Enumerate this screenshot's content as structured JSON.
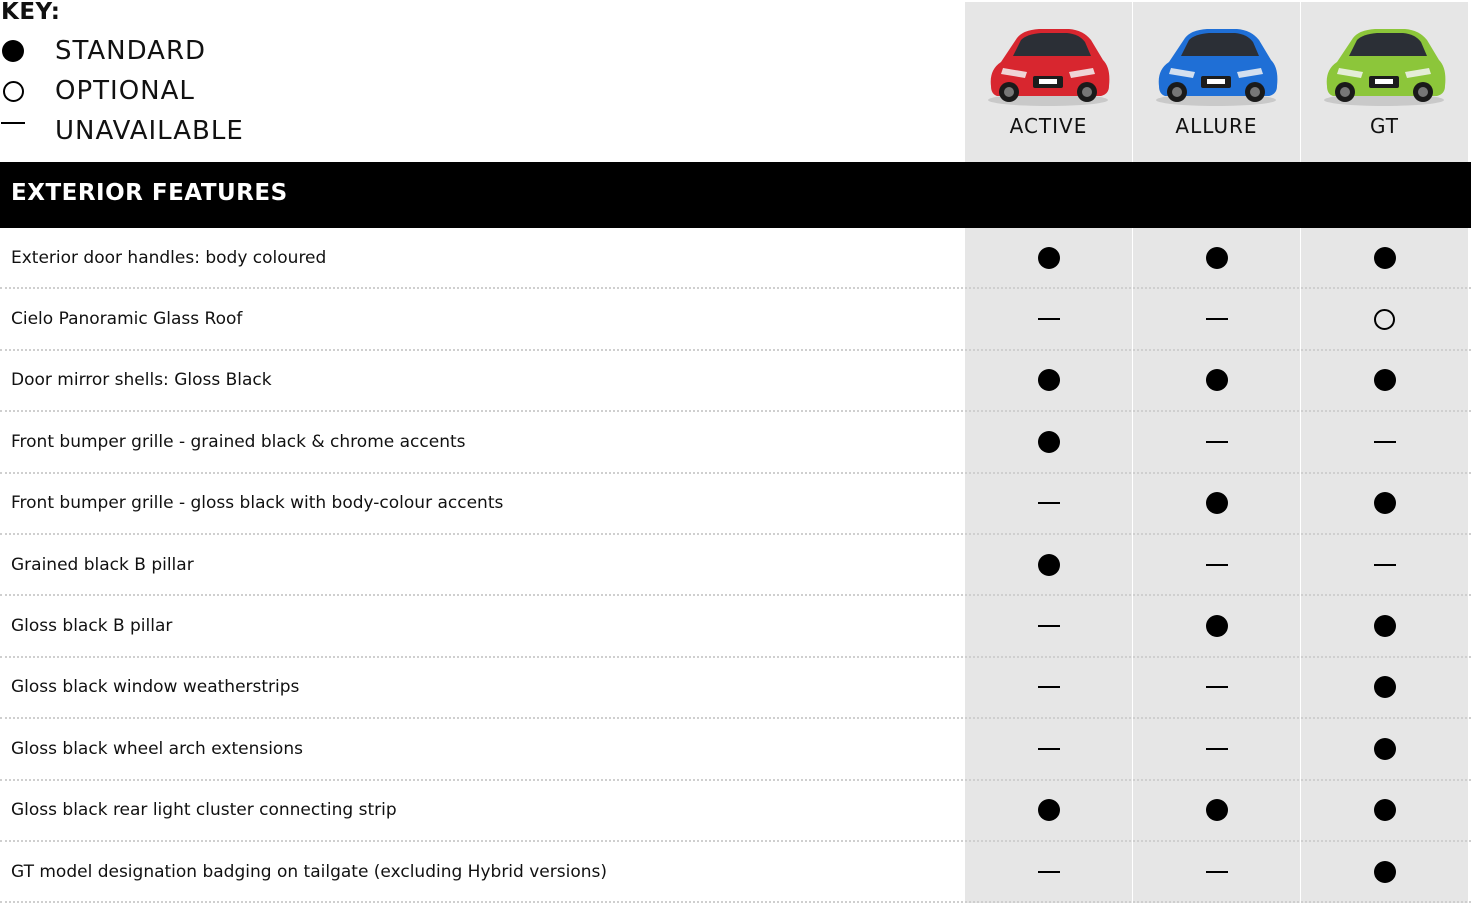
{
  "key": {
    "title": "KEY:",
    "items": [
      {
        "symbol": "filled",
        "label": "STANDARD"
      },
      {
        "symbol": "open",
        "label": "OPTIONAL"
      },
      {
        "symbol": "dash",
        "label": "UNAVAILABLE"
      }
    ]
  },
  "trims": [
    {
      "name": "ACTIVE",
      "car_color": "#d8262f"
    },
    {
      "name": "ALLURE",
      "car_color": "#1f6fd6"
    },
    {
      "name": "GT",
      "car_color": "#8cc63a"
    }
  ],
  "section": {
    "title": "EXTERIOR FEATURES"
  },
  "rows": [
    {
      "feature": "Exterior door handles: body coloured",
      "values": [
        "filled",
        "filled",
        "filled"
      ]
    },
    {
      "feature": "Cielo Panoramic Glass Roof",
      "values": [
        "dash",
        "dash",
        "open"
      ]
    },
    {
      "feature": "Door mirror shells: Gloss Black",
      "values": [
        "filled",
        "filled",
        "filled"
      ]
    },
    {
      "feature": "Front bumper grille - grained black & chrome accents",
      "values": [
        "filled",
        "dash",
        "dash"
      ]
    },
    {
      "feature": "Front bumper grille - gloss black with body-colour accents",
      "values": [
        "dash",
        "filled",
        "filled"
      ]
    },
    {
      "feature": "Grained black B pillar",
      "values": [
        "filled",
        "dash",
        "dash"
      ]
    },
    {
      "feature": "Gloss black B pillar",
      "values": [
        "dash",
        "filled",
        "filled"
      ]
    },
    {
      "feature": "Gloss black window weatherstrips",
      "values": [
        "dash",
        "dash",
        "filled"
      ]
    },
    {
      "feature": "Gloss black wheel arch extensions",
      "values": [
        "dash",
        "dash",
        "filled"
      ]
    },
    {
      "feature": "Gloss black rear light cluster connecting strip",
      "values": [
        "filled",
        "filled",
        "filled"
      ]
    },
    {
      "feature": "GT model designation badging on tailgate (excluding Hybrid versions)",
      "values": [
        "dash",
        "dash",
        "filled"
      ]
    }
  ]
}
